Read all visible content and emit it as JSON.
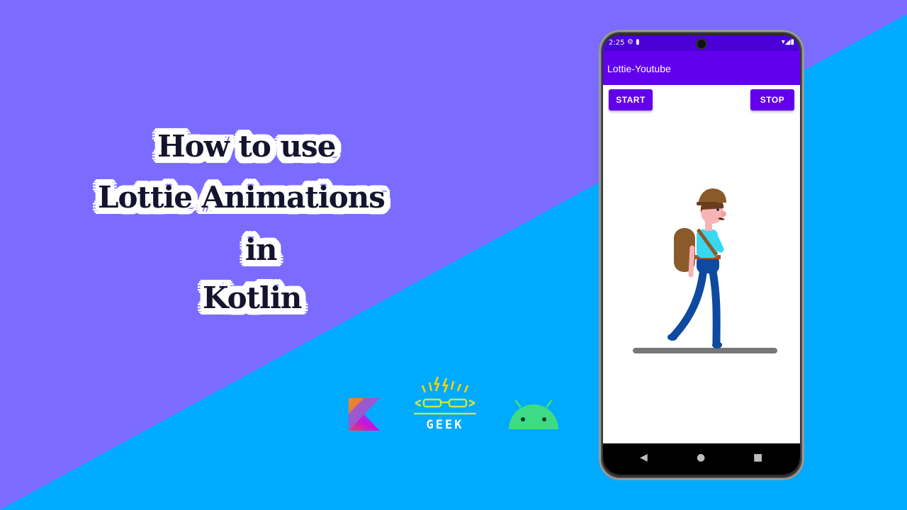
{
  "colors": {
    "background_top": "#7b6cff",
    "background_bottom": "#00aaff",
    "appbar": "#6200ee",
    "statusbar": "#4a00d6",
    "button": "#6200ee"
  },
  "title": {
    "line1": "How to  use",
    "line2": "Lottie Animations",
    "line3": "in",
    "line4": "Kotlin"
  },
  "logos": {
    "kotlin_icon": "kotlin-logo-icon",
    "geek_text": "GEEK",
    "android_icon": "android-head-icon"
  },
  "phone": {
    "status": {
      "time": "2:25",
      "left_icons": "⚙ ▮",
      "right_icons": "▾◢▮"
    },
    "app_title": "Lottie-Youtube",
    "buttons": {
      "start": "START",
      "stop": "STOP"
    },
    "nav": {
      "back": "◀",
      "home": "●",
      "recent": "■"
    }
  }
}
